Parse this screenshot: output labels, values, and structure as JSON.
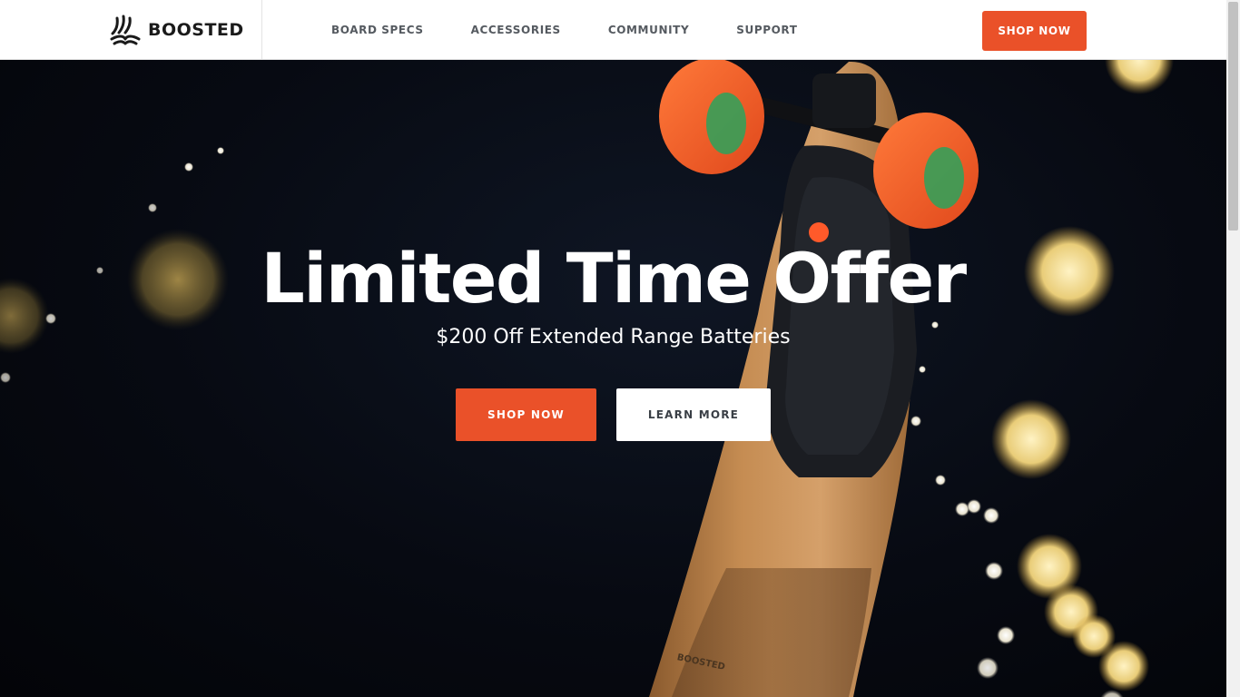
{
  "brand": {
    "name": "BOOSTED",
    "accent": "#ea5129",
    "icon": "boosted-logo-icon"
  },
  "nav": {
    "items": [
      {
        "label": "BOARD SPECS"
      },
      {
        "label": "ACCESSORIES"
      },
      {
        "label": "COMMUNITY"
      },
      {
        "label": "SUPPORT"
      }
    ],
    "cta_label": "SHOP NOW"
  },
  "hero": {
    "title": "Limited Time Offer",
    "subtitle": "$200 Off Extended Range Batteries",
    "primary_label": "SHOP NOW",
    "secondary_label": "LEARN MORE",
    "image": "boosted-skateboard-bokeh-image",
    "board_brand_text": "BOOSTED"
  }
}
